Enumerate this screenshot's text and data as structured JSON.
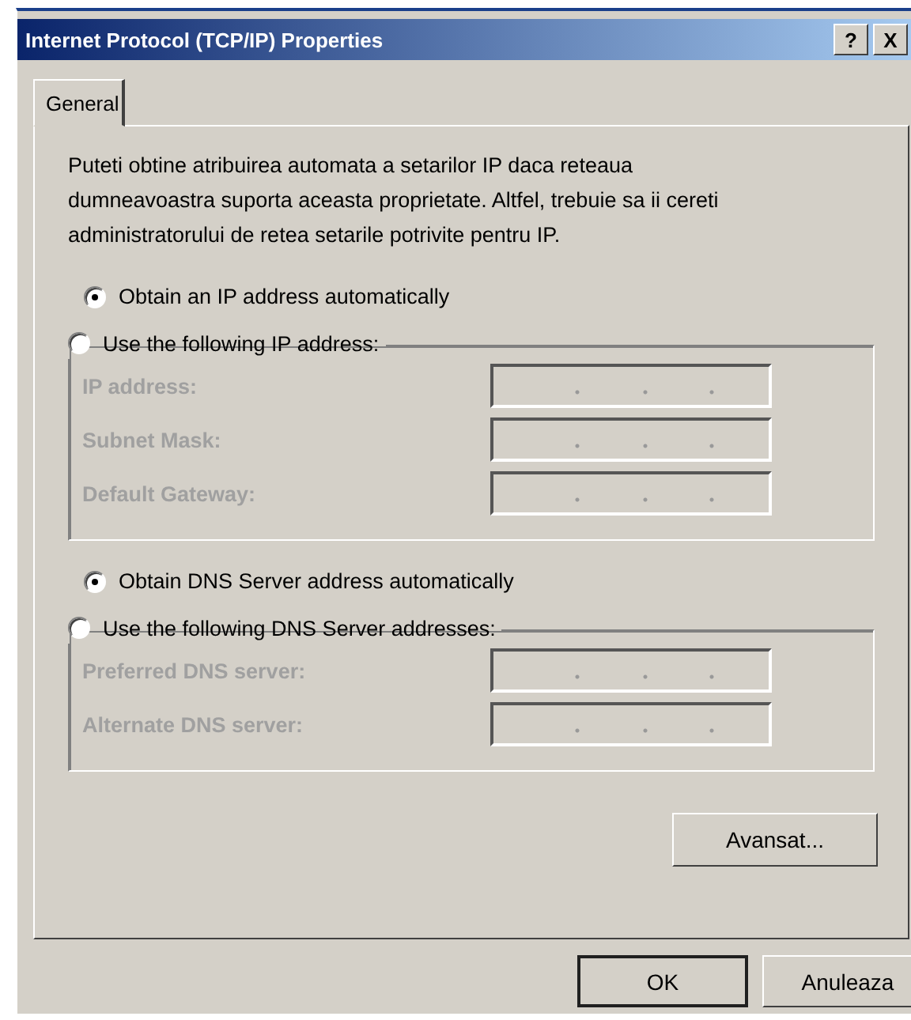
{
  "window": {
    "title": "Internet Protocol (TCP/IP) Properties",
    "title_buttons": [
      "?",
      "X"
    ]
  },
  "tabs": [
    {
      "label": "General",
      "selected": true
    }
  ],
  "description": "Puteti obtine atribuirea automata a setarilor IP daca reteaua dumneavoastra suporta aceasta proprietate.  Altfel, trebuie sa ii cereti administratorului de retea setarile potrivite pentru IP.",
  "ip": {
    "options": [
      {
        "label": "Obtain an IP address automatically",
        "selected": true
      },
      {
        "label": "Use the following IP address:",
        "selected": false
      }
    ],
    "fields": [
      {
        "label": "IP address:",
        "disabled": true
      },
      {
        "label": "Subnet Mask:",
        "disabled": true
      },
      {
        "label": "Default Gateway:",
        "disabled": true
      }
    ]
  },
  "dns": {
    "options": [
      {
        "label": "Obtain DNS Server address automatically",
        "selected": true
      },
      {
        "label": "Use the following DNS Server addresses:",
        "selected": false
      }
    ],
    "fields": [
      {
        "label": "Preferred DNS server:",
        "disabled": true
      },
      {
        "label": "Alternate DNS server:",
        "disabled": true
      }
    ]
  },
  "advanced_button": "Avansat...",
  "dialog_buttons": [
    {
      "label": "OK",
      "default": true
    },
    {
      "label": "Anuleaza",
      "default": false
    }
  ]
}
